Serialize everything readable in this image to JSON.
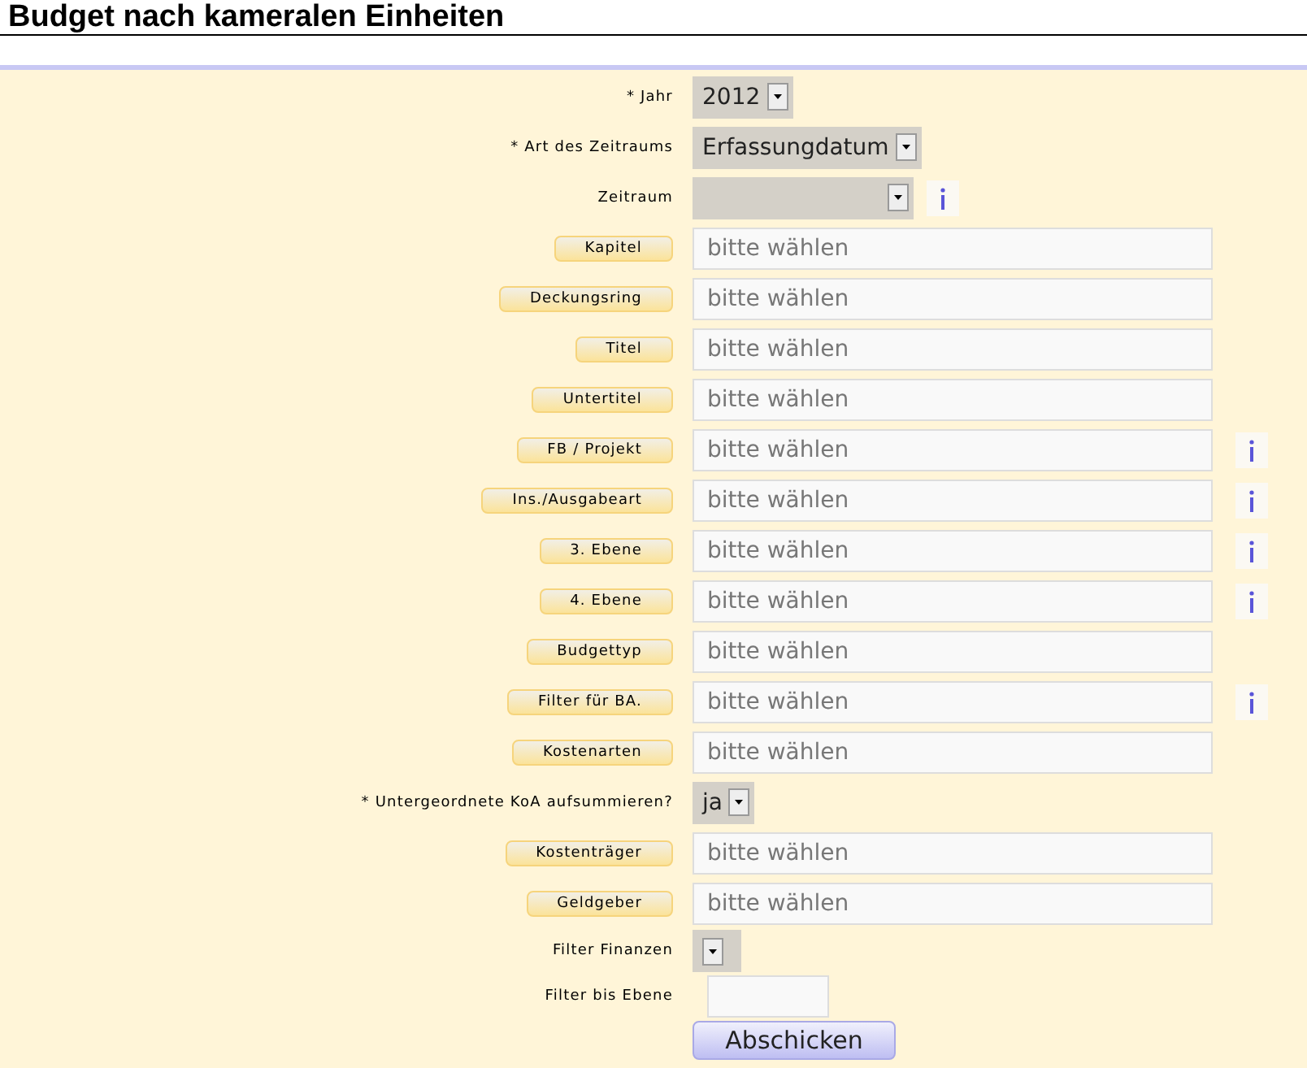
{
  "title": "Budget nach kameralen Einheiten",
  "fields": [
    {
      "kind": "select",
      "label": "* Jahr",
      "value": "2012",
      "info": false
    },
    {
      "kind": "select",
      "label": "* Art des Zeitraums",
      "value": "Erfassungdatum",
      "info": false
    },
    {
      "kind": "select",
      "label": "Zeitraum",
      "info": true
    },
    {
      "kind": "lookup",
      "label": "Kapitel",
      "placeholder": "bitte wählen",
      "info": false
    },
    {
      "kind": "lookup",
      "label": "Deckungsring",
      "placeholder": "bitte wählen",
      "info": false
    },
    {
      "kind": "lookup",
      "label": "Titel",
      "placeholder": "bitte wählen",
      "info": false
    },
    {
      "kind": "lookup",
      "label": "Untertitel",
      "placeholder": "bitte wählen",
      "info": false
    },
    {
      "kind": "lookup",
      "label": "FB / Projekt",
      "placeholder": "bitte wählen",
      "info": true
    },
    {
      "kind": "lookup",
      "label": "Ins./Ausgabeart",
      "placeholder": "bitte wählen",
      "info": true
    },
    {
      "kind": "lookup",
      "label": "3. Ebene",
      "placeholder": "bitte wählen",
      "info": true
    },
    {
      "kind": "lookup",
      "label": "4. Ebene",
      "placeholder": "bitte wählen",
      "info": true
    },
    {
      "kind": "lookup",
      "label": "Budgettyp",
      "placeholder": "bitte wählen",
      "info": false
    },
    {
      "kind": "lookup",
      "label": "Filter für BA.",
      "placeholder": "bitte wählen",
      "info": true
    },
    {
      "kind": "lookup",
      "label": "Kostenarten",
      "placeholder": "bitte wählen",
      "info": false
    },
    {
      "kind": "select",
      "label": "* Untergeordnete KoA aufsummieren?",
      "value": "ja",
      "info": false
    },
    {
      "kind": "lookup",
      "label": "Kostenträger",
      "placeholder": "bitte wählen",
      "info": false
    },
    {
      "kind": "lookup",
      "label": "Geldgeber",
      "placeholder": "bitte wählen",
      "info": false
    },
    {
      "kind": "select",
      "label": "Filter Finanzen",
      "info": false
    },
    {
      "kind": "text",
      "label": "Filter bis Ebene",
      "info": false
    }
  ],
  "submit": "Abschicken"
}
